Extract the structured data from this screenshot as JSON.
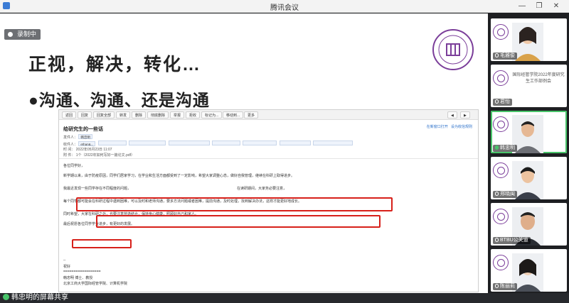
{
  "window": {
    "title": "腾讯会议",
    "controls": [
      "minimize-icon",
      "restore-icon",
      "close-icon"
    ]
  },
  "recording": {
    "label": "录制中"
  },
  "slide": {
    "headline": "正视，解决，转化…",
    "bullet": "●沟通、沟通、还是沟通"
  },
  "email": {
    "toolbar": [
      "返回",
      "回复",
      "回复全部",
      "转发",
      "删除",
      "彻底删除",
      "举报",
      "拒收",
      "标记为...",
      "移动到...",
      "更多"
    ],
    "subject": "给研究生的一些话",
    "from_label": "发件人：",
    "from_value": "韩忠明",
    "to_label": "收件人：",
    "to_value": "ethan&...",
    "time_label": "时 间：",
    "time_value": "2022年05月23日 11:07",
    "attach_label": "附 件：",
    "attach_value": "1个（2022年如何写好一篇论文.pdf）",
    "right_link1": "在新窗口打开",
    "right_link2": "设为收信规则",
    "lines": [
      "各位同学好，",
      "新学期以来，由于防疫原因，同学们居家学习，在学业和生活方面都受到了一定影响，希望大家调整心态，做好自我管理，继续在科研上取得进步。",
      "我最近发现一些同学存在不同程度的问题，",
      "在读研期间，大家务必要注意，",
      "每个同学都可能会在科研过程中遇到困难，可以及时和老师沟通，要多方法问题或者困难，提前沟通，及时处理，找到解决办法，这样才能更好地成长。",
      "同时希望，大家在科研之外，也要注意劳逸结合，保持身心健康，照顾好自己和家人。",
      "最后祝愿各位同学学业进步，有更好的发展。",
      "--",
      "祝好",
      "==================",
      "韩忠明 博士、教授",
      "北京工商大学国际经管学院、计算机学院"
    ],
    "hl_text1": "我要做的事，可能对你们年轻人有一些参考，",
    "hl_text2": "每个同学都可能会在科研过程中遇到困难，可以及时和老师沟通，要多方法问题或者困难，",
    "hl_text3": "同学学业进步，有更好的发展。"
  },
  "share_bar": {
    "label": "韩忠明的屏幕共享"
  },
  "participants": [
    {
      "name": "毛雅俊",
      "type": "camera",
      "muted": true
    },
    {
      "name": "君怡",
      "type": "banner",
      "muted": true
    },
    {
      "name": "韩忠明",
      "type": "camera",
      "speaking": true
    },
    {
      "name": "郑晓闽",
      "type": "camera",
      "muted": true
    },
    {
      "name": "BTBU公关道",
      "type": "camera",
      "muted": true
    },
    {
      "name": "陈丽莉",
      "type": "camera",
      "muted": true
    }
  ],
  "banner_text": "国际经管学院2022年度研究生工作部例会",
  "colors": {
    "highlight": "#d7201a",
    "accent_green": "#49c46a",
    "logo_purple": "#7b3e9a"
  }
}
